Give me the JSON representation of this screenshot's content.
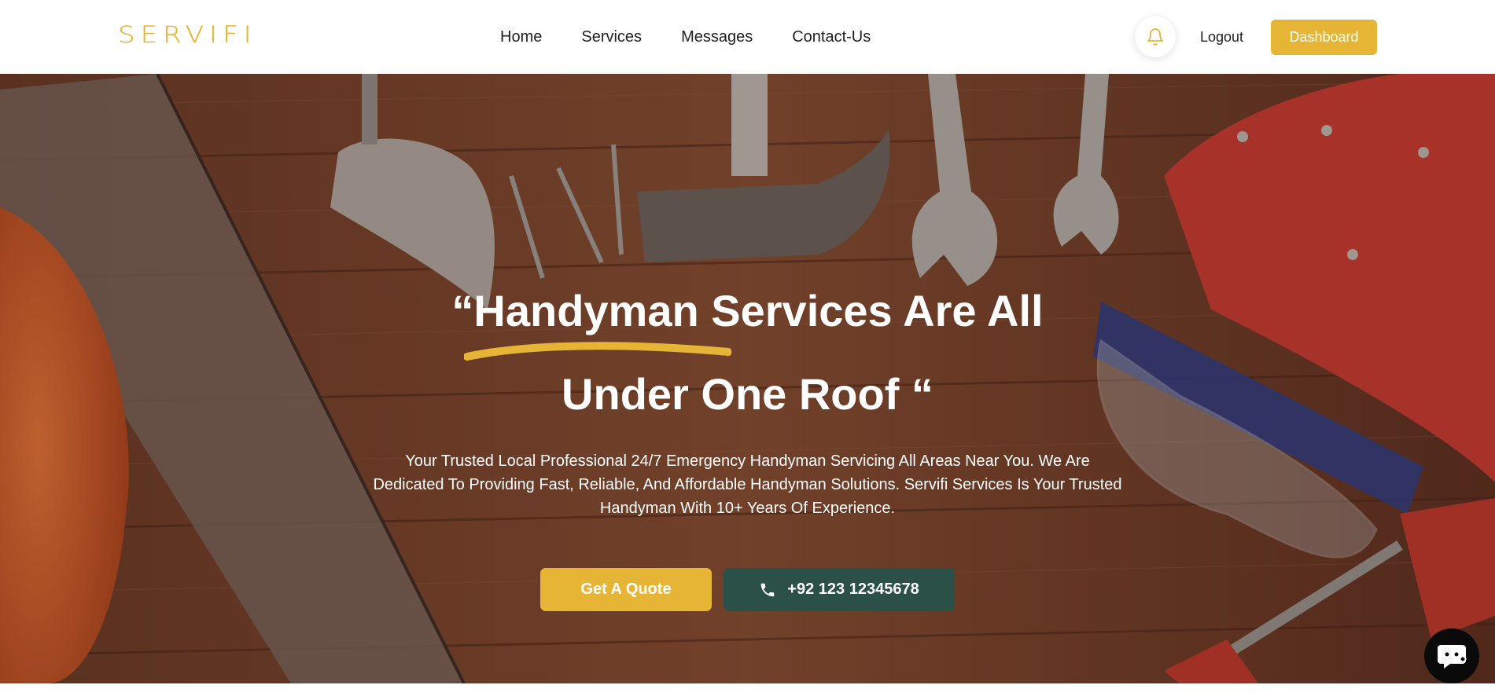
{
  "brand": {
    "logo_text": "SERVIFI",
    "accent_color": "#e7b535",
    "dark_green": "#2a5047"
  },
  "nav": {
    "links": [
      {
        "label": "Home"
      },
      {
        "label": "Services"
      },
      {
        "label": "Messages"
      },
      {
        "label": "Contact-Us"
      }
    ],
    "bell_icon": "bell-icon",
    "logout_label": "Logout",
    "dashboard_label": "Dashboard"
  },
  "hero": {
    "title_line1": "“Handyman Services Are All",
    "title_line2": "Under One Roof “",
    "description": "Your Trusted Local Professional 24/7 Emergency Handyman Servicing All Areas Near You. We Are Dedicated To Providing Fast, Reliable, And Affordable Handyman Solutions. Servifi Services Is Your Trusted Handyman With 10+ Years Of Experience.",
    "quote_button": "Get A Quote",
    "phone_button": "+92 123 12345678",
    "phone_icon": "phone-icon"
  },
  "chat": {
    "icon": "chat-icon"
  }
}
